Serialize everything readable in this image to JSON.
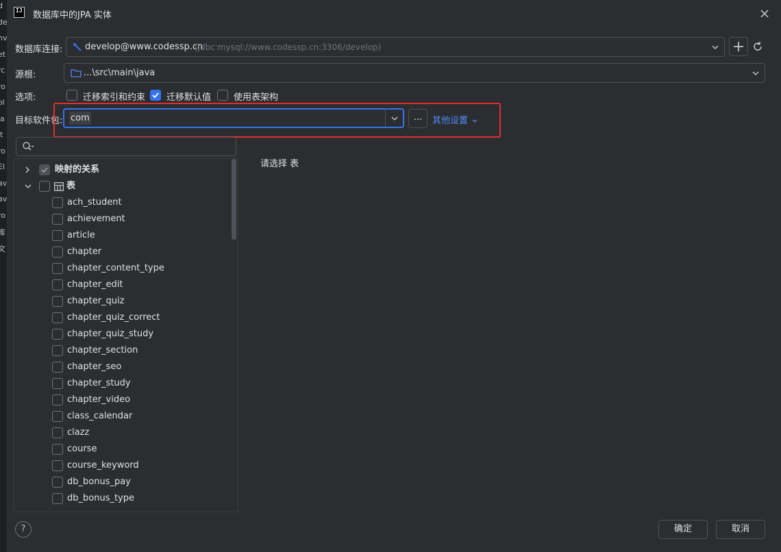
{
  "window": {
    "title": "数据库中的JPA 实体"
  },
  "db_connection": {
    "label": "数据库连接:",
    "name": "develop@www.codessp.cn",
    "url": "(jdbc:mysql://www.codessp.cn:3306/develop)"
  },
  "source_root": {
    "label": "源根:",
    "value": "...\\src\\main\\java"
  },
  "options": {
    "label": "选项:",
    "items": [
      {
        "label": "迁移索引和约束",
        "checked": false
      },
      {
        "label": "迁移默认值",
        "checked": true
      },
      {
        "label": "使用表架构",
        "checked": false
      }
    ]
  },
  "target_package": {
    "label": "目标软件包:",
    "value": "com",
    "browse_label": "...",
    "more_settings_label": "其他设置"
  },
  "search": {
    "placeholder": ""
  },
  "tree": {
    "mapped_relations_label": "映射的关系",
    "tables_label": "表",
    "tables": [
      "ach_student",
      "achievement",
      "article",
      "chapter",
      "chapter_content_type",
      "chapter_edit",
      "chapter_quiz",
      "chapter_quiz_correct",
      "chapter_quiz_study",
      "chapter_section",
      "chapter_seo",
      "chapter_study",
      "chapter_video",
      "class_calendar",
      "clazz",
      "course",
      "course_keyword",
      "db_bonus_pay",
      "db_bonus_type"
    ]
  },
  "detail": {
    "placeholder_text": "请选择 表"
  },
  "footer": {
    "help_label": "?",
    "ok_label": "确定",
    "cancel_label": "取消"
  },
  "background_letters": [
    "d",
    "de",
    "nv",
    "et",
    "rc",
    "ro",
    "ol",
    "la",
    "it",
    "ro",
    "El",
    "av",
    "av",
    "ro",
    "库",
    "文"
  ],
  "colors": {
    "accent": "#3574f0",
    "highlight": "#e0312d",
    "background": "#2b2d30",
    "link": "#548af7"
  }
}
